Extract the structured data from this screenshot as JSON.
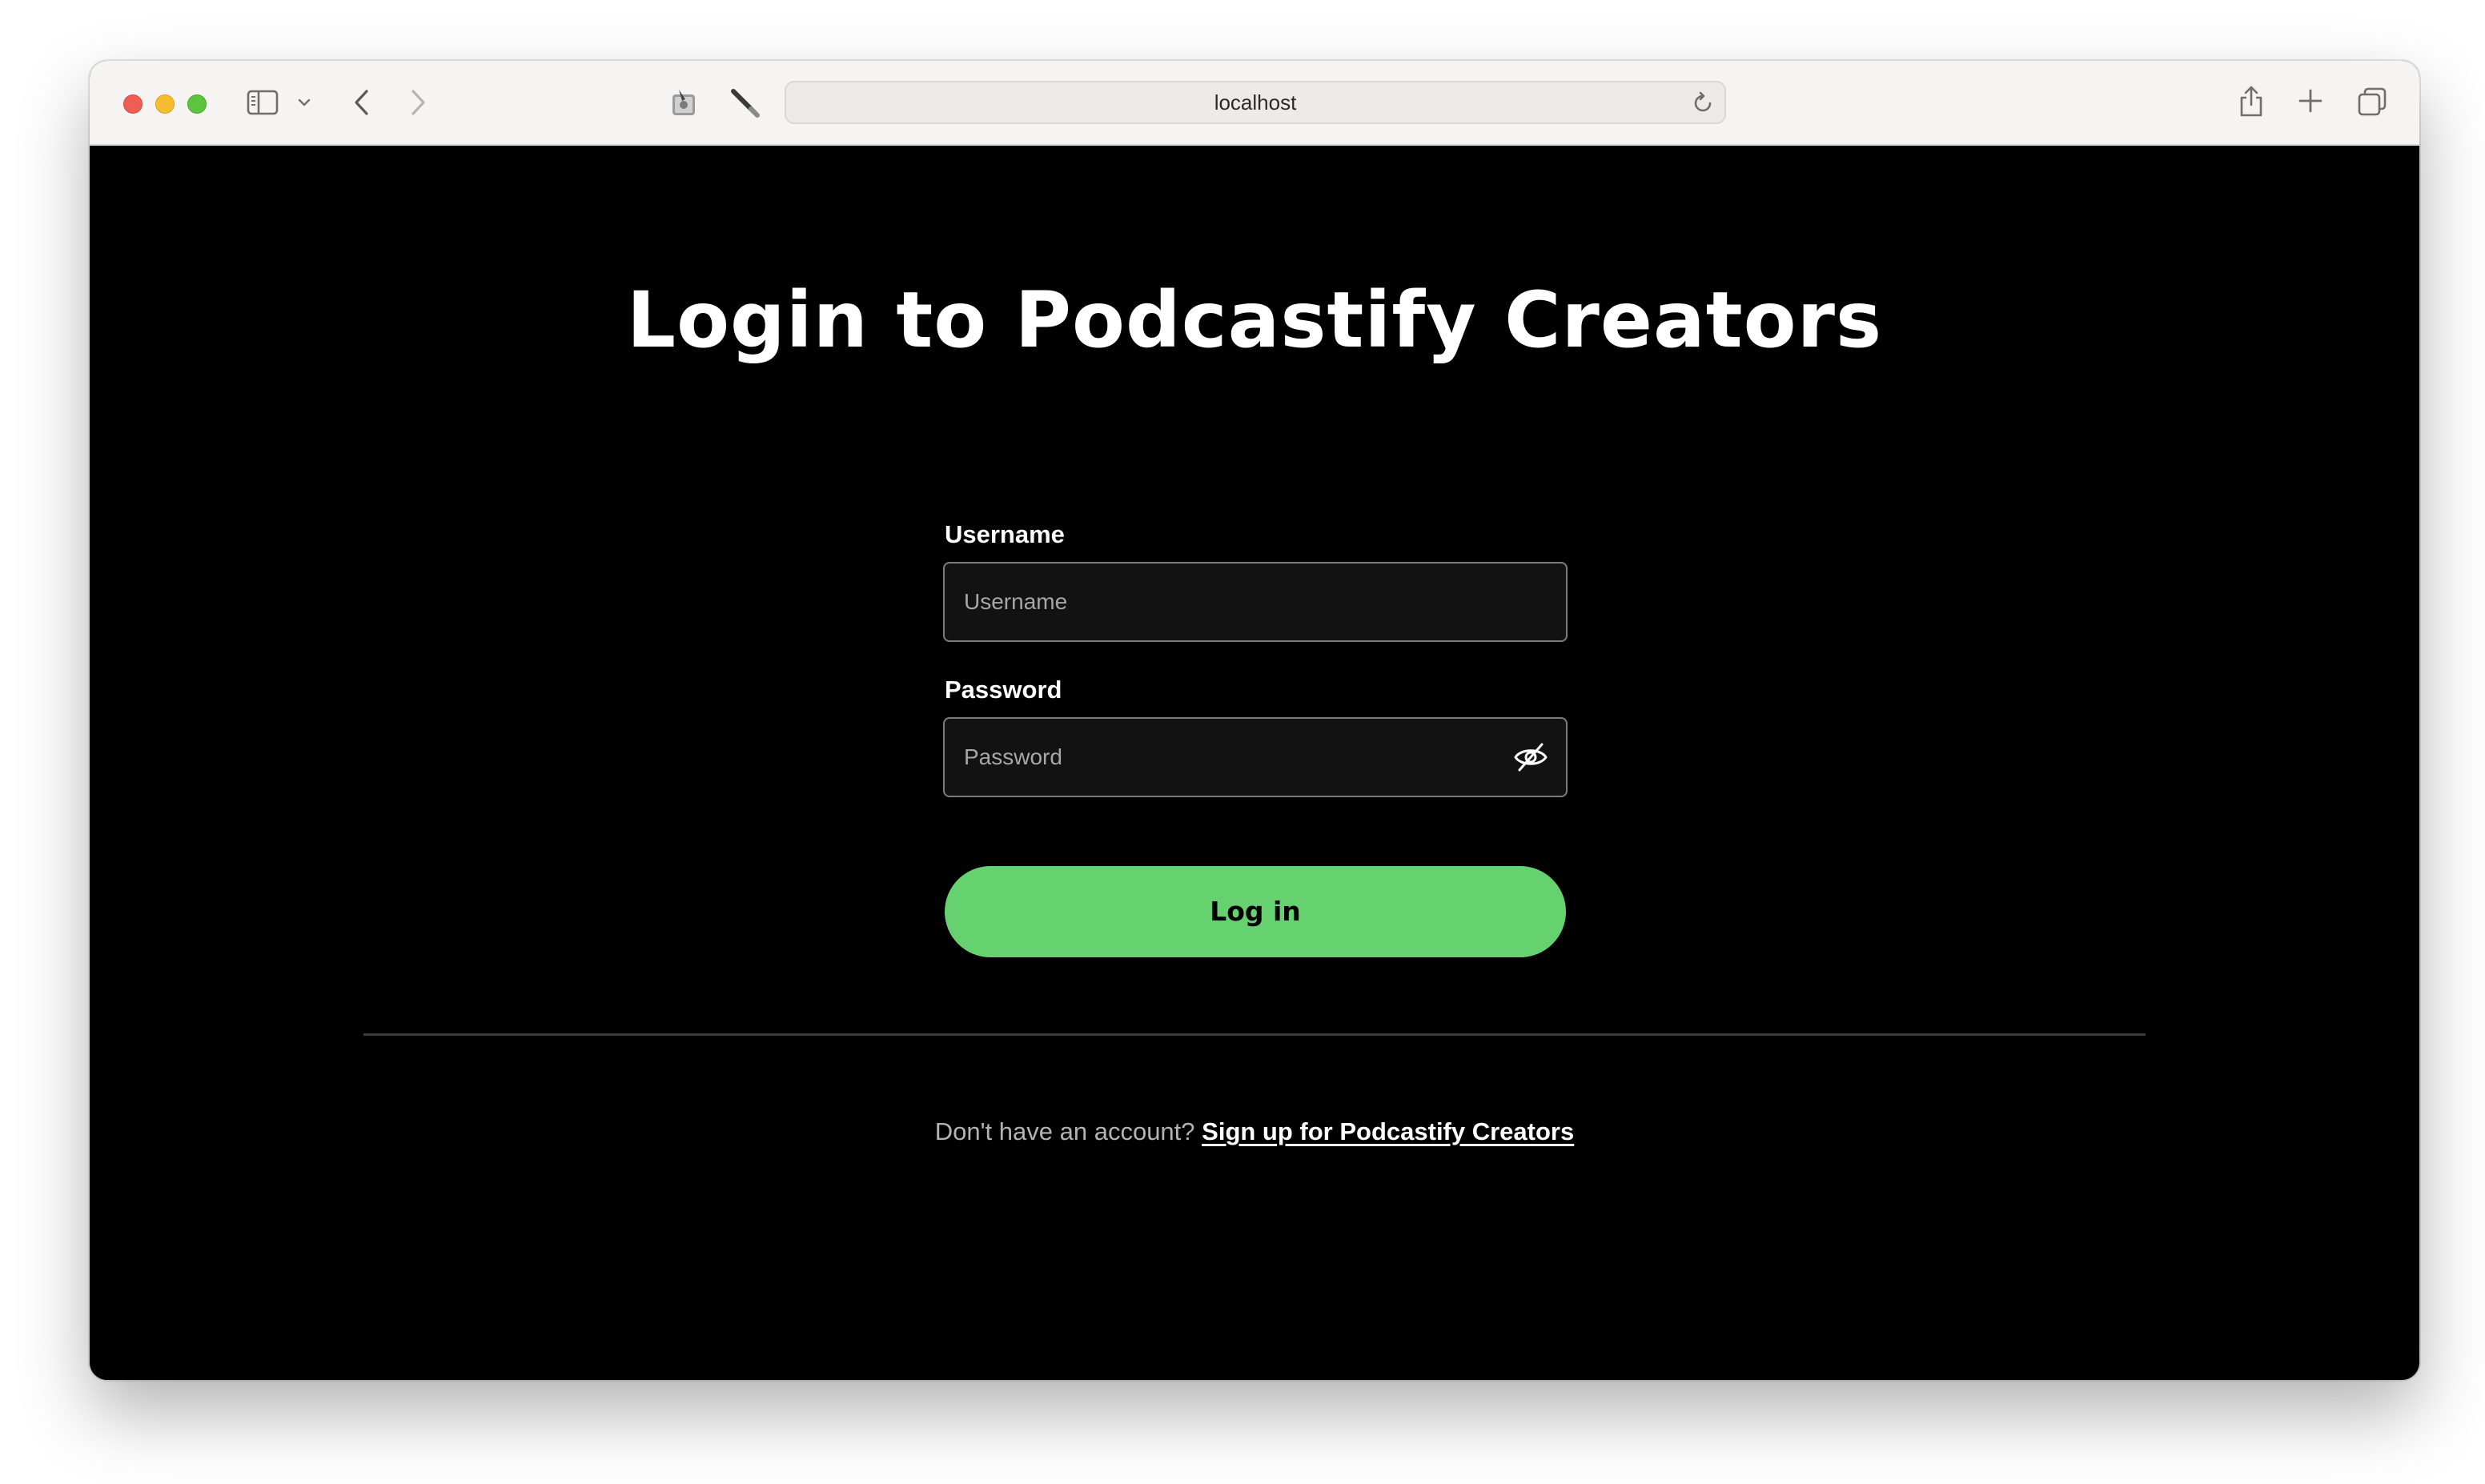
{
  "browser": {
    "address": "localhost",
    "icons": {
      "close": "close-dot",
      "minimize": "minimize-dot",
      "zoom": "zoom-dot",
      "sidebar": "sidebar-icon",
      "back": "back-arrow-icon",
      "forward": "forward-arrow-icon",
      "share": "share-icon",
      "new_tab": "plus-icon",
      "tabs": "tabs-overview-icon",
      "reload": "reload-icon"
    }
  },
  "login": {
    "title": "Login to Podcastify Creators",
    "username_label": "Username",
    "username_placeholder": "Username",
    "password_label": "Password",
    "password_placeholder": "Password",
    "login_button": "Log in",
    "signup_prompt": "Don't have an account?",
    "signup_link": "Sign up for Podcastify Creators"
  },
  "colors": {
    "background": "#000000",
    "accent": "#65d26f",
    "input_bg": "#121212",
    "input_border": "#7c7c7c"
  }
}
